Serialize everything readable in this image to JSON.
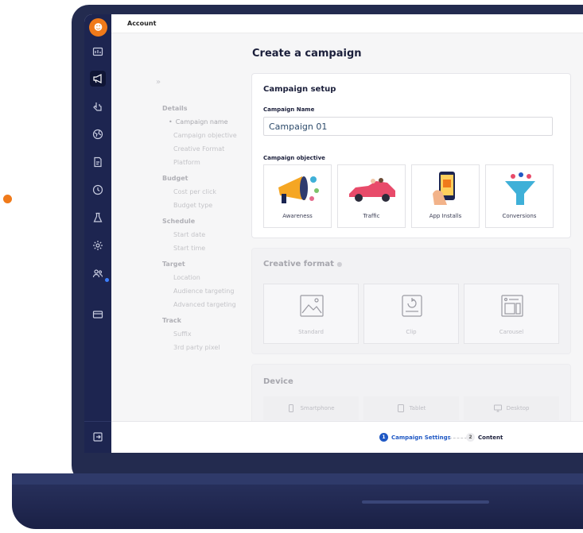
{
  "topbar": {
    "title": "Account"
  },
  "page": {
    "title": "Create a campaign"
  },
  "nav": {
    "groups": [
      {
        "label": "Details",
        "items": [
          "Campaign name",
          "Campaign objective",
          "Creative Format",
          "Platform"
        ]
      },
      {
        "label": "Budget",
        "items": [
          "Cost per click",
          "Budget type"
        ]
      },
      {
        "label": "Schedule",
        "items": [
          "Start date",
          "Start time"
        ]
      },
      {
        "label": "Target",
        "items": [
          "Location",
          "Audience targeting",
          "Advanced targeting"
        ]
      },
      {
        "label": "Track",
        "items": [
          "Suffix",
          "3rd party pixel"
        ]
      }
    ],
    "current_marker": "•"
  },
  "setup": {
    "title": "Campaign setup",
    "name_label": "Campaign Name",
    "name_value": "Campaign 01",
    "objective_label": "Campaign objective",
    "objectives": [
      "Awareness",
      "Traffic",
      "App Installs",
      "Conversions"
    ]
  },
  "creative": {
    "title": "Creative format",
    "formats": [
      "Standard",
      "Clip",
      "Carousel"
    ]
  },
  "device": {
    "title": "Device",
    "options": [
      "Smartphone",
      "Tablet",
      "Desktop"
    ]
  },
  "steps": [
    {
      "num": "1",
      "label": "Campaign Settings"
    },
    {
      "num": "2",
      "label": "Content"
    }
  ],
  "colors": {
    "sidebar": "#1d2550",
    "accent": "#f07a1a",
    "primary": "#1f58c4"
  },
  "icons": [
    "reports-icon",
    "megaphone-icon",
    "pointer-icon",
    "globe-icon",
    "document-icon",
    "clock-icon",
    "flask-icon",
    "gear-icon",
    "users-icon",
    "card-icon",
    "exit-icon"
  ]
}
